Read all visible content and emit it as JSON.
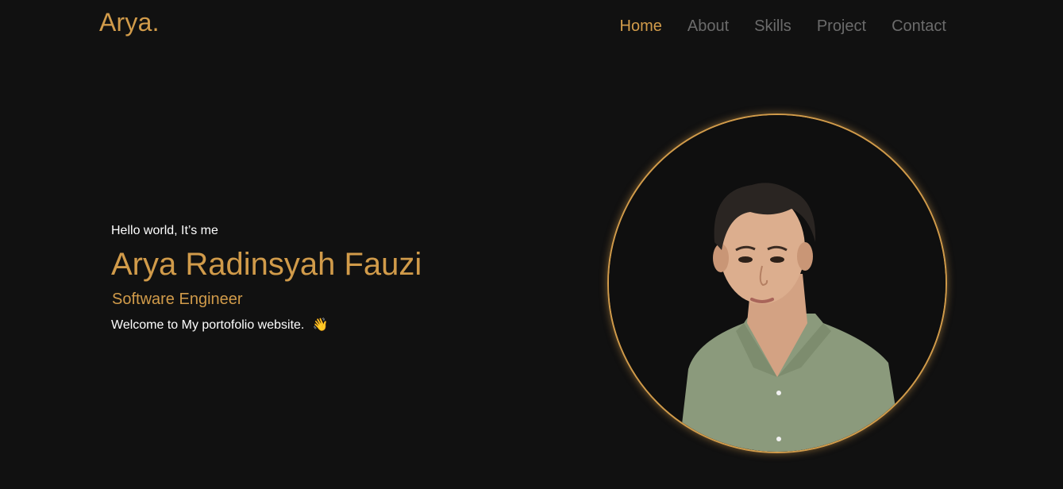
{
  "brand": {
    "logo": "Arya."
  },
  "nav": {
    "items": [
      {
        "label": "Home",
        "active": true
      },
      {
        "label": "About",
        "active": false
      },
      {
        "label": "Skills",
        "active": false
      },
      {
        "label": "Project",
        "active": false
      },
      {
        "label": "Contact",
        "active": false
      }
    ]
  },
  "hero": {
    "greeting": "Hello world, It’s me",
    "name": "Arya Radinsyah Fauzi",
    "role": "Software Engineer",
    "welcome": "Welcome to My portofolio website.",
    "wave_emoji": "👋"
  },
  "theme": {
    "accent": "#d19b4a",
    "background": "#111111",
    "nav_inactive": "#6b6b6b",
    "text": "#ffffff"
  },
  "icons": {
    "wave": "waving-hand-icon"
  }
}
